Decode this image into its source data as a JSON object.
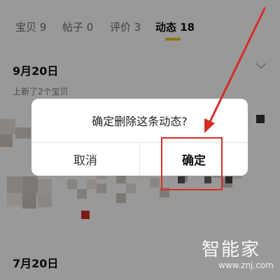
{
  "tabs": [
    {
      "label": "宝贝 9"
    },
    {
      "label": "帖子 0"
    },
    {
      "label": "评价 3"
    },
    {
      "label": "动态 18",
      "active": true
    }
  ],
  "feed": {
    "date_1": "9月20日",
    "update_text": "上新了2个宝贝",
    "date_2": "7月20日"
  },
  "dialog": {
    "message": "确定删除这条动态?",
    "cancel_label": "取消",
    "confirm_label": "确定"
  },
  "annotation": {
    "color": "#d42e24"
  },
  "watermark": {
    "logo": "智能家",
    "url": "www.znj.com"
  },
  "colors": {
    "accent_yellow": "#f2c21a",
    "overlay": "rgba(0,0,0,0.40)"
  }
}
